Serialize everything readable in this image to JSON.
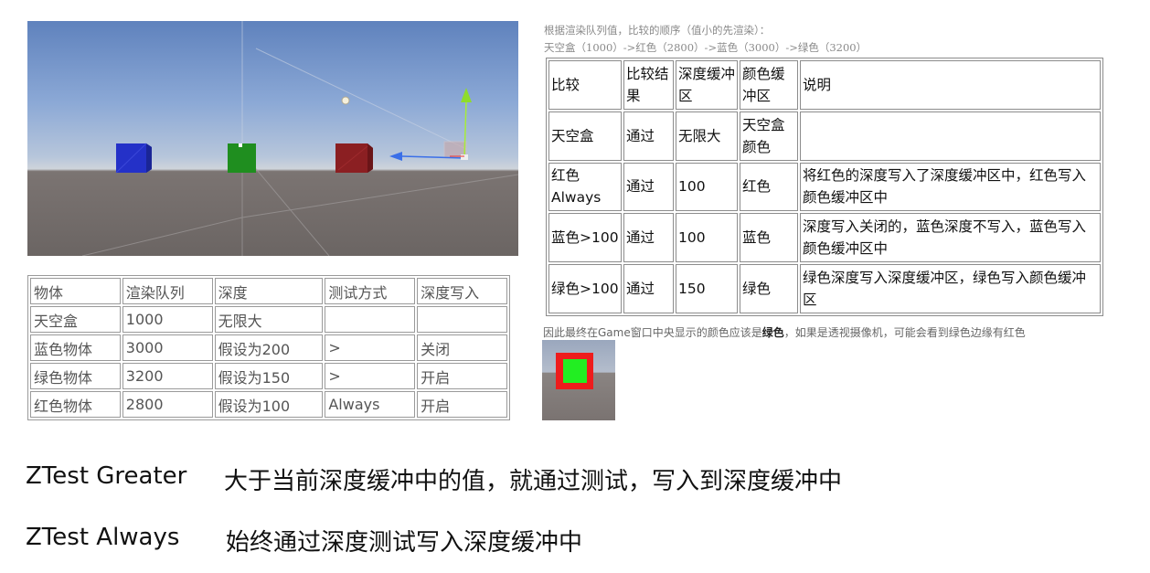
{
  "left_table": {
    "header": [
      "物体",
      "渲染队列",
      "深度",
      "测试方式",
      "深度写入"
    ],
    "rows": [
      [
        "天空盒",
        "1000",
        "无限大",
        "",
        ""
      ],
      [
        "蓝色物体",
        "3000",
        "假设为200",
        ">",
        "关闭"
      ],
      [
        "绿色物体",
        "3200",
        "假设为150",
        ">",
        "开启"
      ],
      [
        "红色物体",
        "2800",
        "假设为100",
        "Always",
        "开启"
      ]
    ]
  },
  "note": {
    "line1": "根据渲染队列值，比较的顺序（值小的先渲染）：",
    "line2": "天空盒（1000）->红色（2800）->蓝色（3000）->绿色（3200）"
  },
  "right_table": {
    "header": [
      "比较",
      "比较结果",
      "深度缓冲区",
      "颜色缓冲区",
      "说明"
    ],
    "rows": [
      [
        "天空盒",
        "通过",
        "无限大",
        "天空盒颜色",
        ""
      ],
      [
        "红色Always",
        "通过",
        "100",
        "红色",
        "将红色的深度写入了深度缓冲区中，红色写入颜色缓冲区中"
      ],
      [
        "蓝色>100",
        "通过",
        "100",
        "蓝色",
        "深度写入关闭的，蓝色深度不写入，蓝色写入颜色缓冲区中"
      ],
      [
        "绿色>100",
        "通过",
        "150",
        "绿色",
        "绿色深度写入深度缓冲区，绿色写入颜色缓冲区"
      ]
    ]
  },
  "conclusion": {
    "before": "因此最终在Game窗口中央显示的颜色应该是",
    "bold": "绿色",
    "after": "，如果是透视摄像机，可能会看到绿色边缘有红色"
  },
  "explanations": {
    "greater_cmd": "ZTest Greater",
    "greater_desc": "大于当前深度缓冲中的值，就通过测试，写入到深度缓冲中",
    "always_cmd": "ZTest Always",
    "always_desc": "始终通过深度测试写入深度缓冲中"
  },
  "colors": {
    "cube_blue": "#2431c8",
    "cube_green": "#1f8e1f",
    "cube_red": "#8b1f22",
    "thumb_red": "#ee1c1c",
    "thumb_green": "#22ee22",
    "gizmo_y": "#a6ec3a",
    "gizmo_x": "#3a6fe8"
  }
}
